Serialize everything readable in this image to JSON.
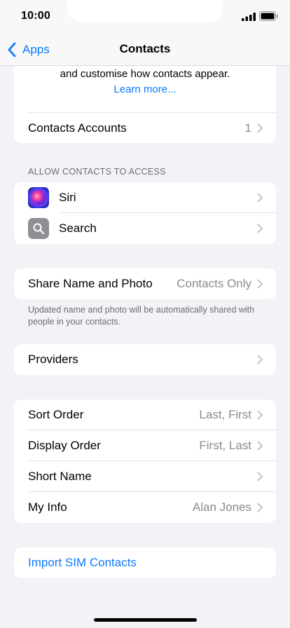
{
  "status_bar": {
    "time": "10:00"
  },
  "nav": {
    "back_label": "Apps",
    "title": "Contacts"
  },
  "intro": {
    "text": "and customise how contacts appear.",
    "link": "Learn more..."
  },
  "accounts_row": {
    "label": "Contacts Accounts",
    "value": "1"
  },
  "access_section": {
    "header": "ALLOW CONTACTS TO ACCESS",
    "items": [
      {
        "label": "Siri",
        "icon": "siri-icon"
      },
      {
        "label": "Search",
        "icon": "search-icon"
      }
    ]
  },
  "share_row": {
    "label": "Share Name and Photo",
    "value": "Contacts Only",
    "footer": "Updated name and photo will be automatically shared with people in your contacts."
  },
  "providers_row": {
    "label": "Providers"
  },
  "display_section": {
    "items": [
      {
        "label": "Sort Order",
        "value": "Last, First"
      },
      {
        "label": "Display Order",
        "value": "First, Last"
      },
      {
        "label": "Short Name",
        "value": ""
      },
      {
        "label": "My Info",
        "value": "Alan Jones"
      }
    ]
  },
  "import_row": {
    "label": "Import SIM Contacts"
  },
  "colors": {
    "accent": "#0a7aff",
    "secondary_text": "#8a8a8e",
    "background": "#f2f2f7"
  }
}
